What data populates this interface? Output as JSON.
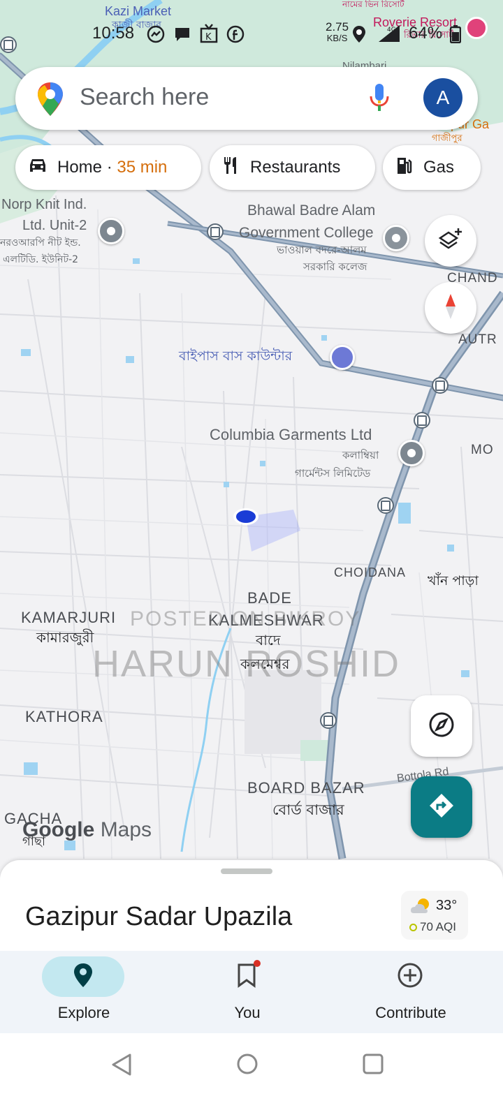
{
  "status_bar": {
    "time": "10:58",
    "net_speed": "2.75",
    "net_unit": "KB/S",
    "battery": "64%"
  },
  "search": {
    "placeholder": "Search here",
    "avatar_letter": "A"
  },
  "chips": [
    {
      "label": "Home · ",
      "eta": "35 min"
    },
    {
      "label": "Restaurants"
    },
    {
      "label": "Gas"
    }
  ],
  "map_labels": {
    "kazi_market": "Kazi Market",
    "kazi_market_bn": "কাজী বাজার",
    "roverie_resort": "Roverie Resort",
    "roverie_resort_bn": "রিভার রিসোর্ট",
    "nilambari": "Nilambari",
    "top_bn": "নামের ভিন রিসোর্ট",
    "gazipur_ga": "Gazipur Ga",
    "gazipur_bn": "গাজীপুর",
    "norp_knit_1": "Norp Knit Ind.",
    "norp_knit_2": "Ltd. Unit-2",
    "norp_knit_bn_1": "নরওআরপি নীট ইন্ড.",
    "norp_knit_bn_2": "এলটিডি. ইউনিট-2",
    "bhawal_1": "Bhawal Badre Alam",
    "bhawal_2": "Government College",
    "bhawal_bn_1": "ভাওয়াল বদরে-আলম",
    "bhawal_bn_2": "সরকারি কলেজ",
    "chand": "CHAND",
    "autr": "AUTR",
    "bypass_bus": "বাইপাস বাস কাউন্টার",
    "columbia": "Columbia Garments Ltd",
    "columbia_bn_1": "কলাম্বিয়া",
    "columbia_bn_2": "গার্মেন্টস লিমিটেড",
    "mo": "MO",
    "choidana": "CHOIDANA",
    "khan_para_bn": "খাঁন পাড়া",
    "bade": "BADE",
    "kalmeshwar": "KALMESHWAR",
    "bade_bn": "বাদে",
    "kalmeshwar_bn": "কলমেশ্বর",
    "kamarjuri": "KAMARJURI",
    "kamarjuri_bn": "কামারজুরী",
    "kathora": "KATHORA",
    "board_bazar": "BOARD BAZAR",
    "board_bazar_bn": "বোর্ড বাজার",
    "bottola": "Bottola Rd",
    "gacha": "GACHA",
    "gacha_bn": "গাছা"
  },
  "watermark": {
    "line1": "POSTED ON BIKROY",
    "line2": "HARUN ROSHID"
  },
  "map_logo": {
    "google": "Google",
    "maps": "Maps"
  },
  "sheet": {
    "place_name": "Gazipur Sadar Upazila",
    "temperature": "33°",
    "aqi": "70 AQI"
  },
  "nav": {
    "explore": "Explore",
    "you": "You",
    "contribute": "Contribute"
  },
  "colors": {
    "accent": "#0b7c85",
    "eta": "#d56e0c",
    "avatar": "#1a4fa0",
    "active_tab": "#c3e8f0"
  },
  "icons": [
    "maps-pin-icon",
    "mic-icon",
    "car-icon",
    "restaurant-icon",
    "gas-station-icon",
    "layers-icon",
    "compass-icon",
    "locate-icon",
    "directions-icon",
    "explore-icon",
    "bookmark-icon",
    "add-circle-icon"
  ]
}
